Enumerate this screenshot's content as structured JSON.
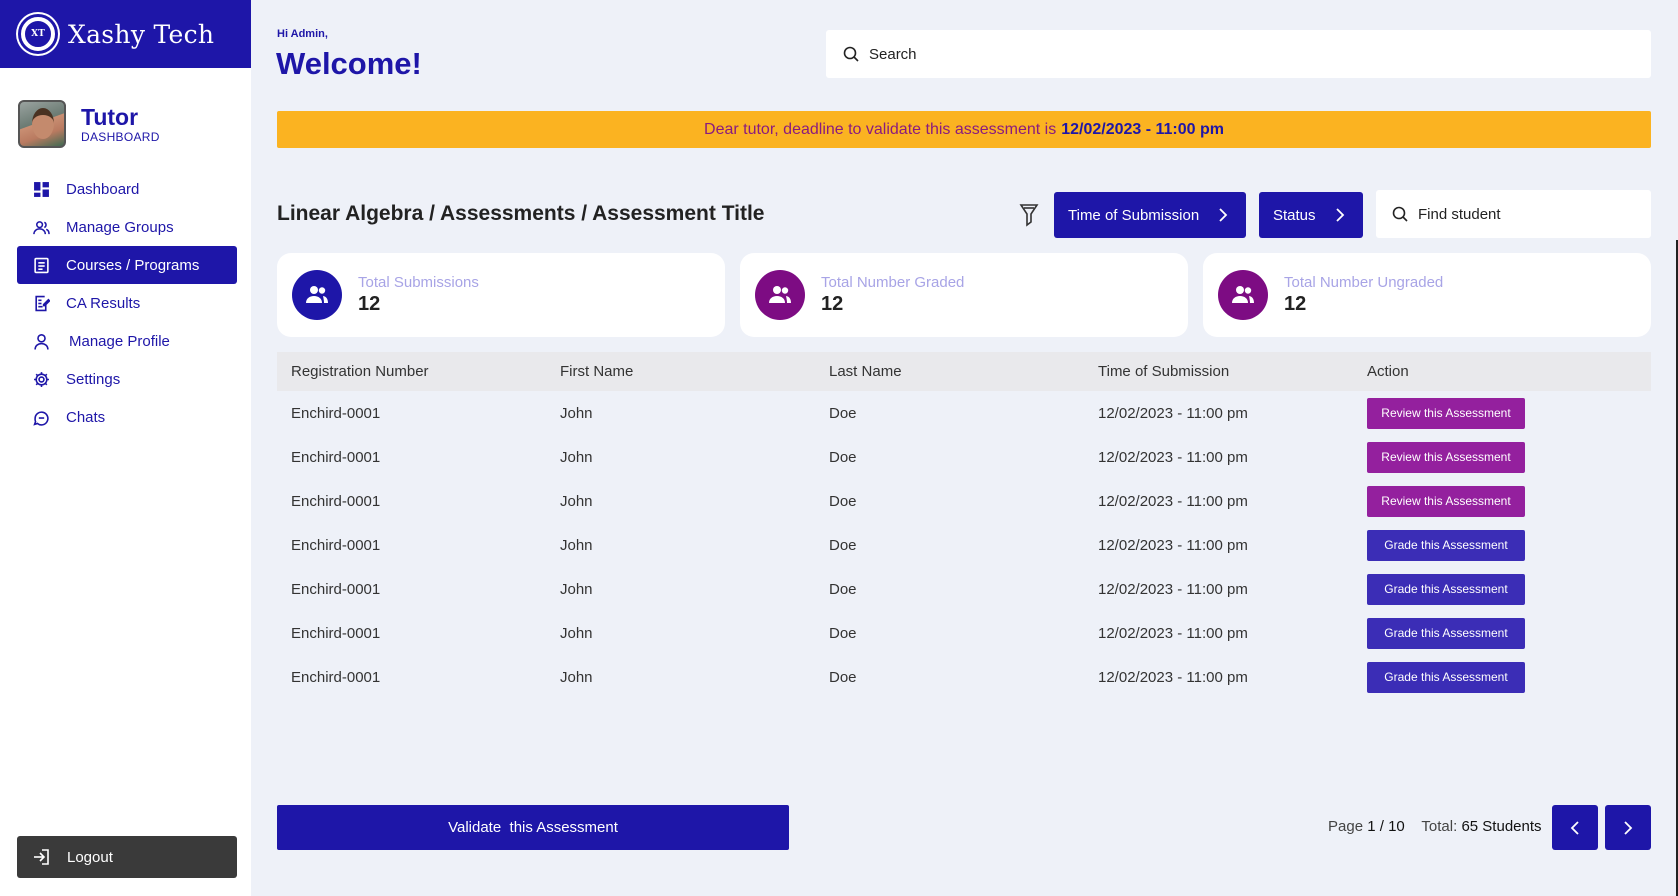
{
  "brand": {
    "name": "Xashy Tech",
    "logo_text": "XT"
  },
  "profile": {
    "role": "Tutor",
    "subtitle": "DASHBOARD"
  },
  "nav": [
    {
      "label": "Dashboard",
      "icon": "dashboard-icon"
    },
    {
      "label": "Manage Groups",
      "icon": "users-icon"
    },
    {
      "label": "Courses / Programs",
      "icon": "document-icon",
      "active": true
    },
    {
      "label": "CA Results",
      "icon": "edit-document-icon"
    },
    {
      "label": "Manage Profile",
      "icon": "user-icon"
    },
    {
      "label": "Settings",
      "icon": "gear-icon"
    },
    {
      "label": "Chats",
      "icon": "chat-icon"
    }
  ],
  "logout": {
    "label": "Logout",
    "icon": "logout-icon"
  },
  "header": {
    "greeting": "Hi Admin,",
    "title": "Welcome!",
    "search_placeholder": "Search"
  },
  "banner": {
    "text": "Dear tutor, deadline to validate this assessment is",
    "deadline": "12/02/2023 - 11:00 pm"
  },
  "breadcrumb": "Linear Algebra / Assessments / Assessment Title",
  "filters": {
    "time_label": "Time of Submission",
    "status_label": "Status",
    "find_placeholder": "Find student"
  },
  "stats": [
    {
      "label": "Total Submissions",
      "value": "12",
      "color": "#1e16a8"
    },
    {
      "label": "Total Number Graded",
      "value": "12",
      "color": "#7d0c83"
    },
    {
      "label": "Total Number Ungraded",
      "value": "12",
      "color": "#7d0c83"
    }
  ],
  "table": {
    "headers": [
      "Registration Number",
      "First Name",
      "Last Name",
      "Time of Submission",
      "Action"
    ],
    "rows": [
      {
        "reg": "Enchird-0001",
        "first": "John",
        "last": "Doe",
        "time": "12/02/2023 - 11:00 pm",
        "action": "Review this Assessment",
        "type": "review"
      },
      {
        "reg": "Enchird-0001",
        "first": "John",
        "last": "Doe",
        "time": "12/02/2023 - 11:00 pm",
        "action": "Review this Assessment",
        "type": "review"
      },
      {
        "reg": "Enchird-0001",
        "first": "John",
        "last": "Doe",
        "time": "12/02/2023 - 11:00 pm",
        "action": "Review this Assessment",
        "type": "review"
      },
      {
        "reg": "Enchird-0001",
        "first": "John",
        "last": "Doe",
        "time": "12/02/2023 - 11:00 pm",
        "action": "Grade this Assessment",
        "type": "grade"
      },
      {
        "reg": "Enchird-0001",
        "first": "John",
        "last": "Doe",
        "time": "12/02/2023 - 11:00 pm",
        "action": "Grade this Assessment",
        "type": "grade"
      },
      {
        "reg": "Enchird-0001",
        "first": "John",
        "last": "Doe",
        "time": "12/02/2023 - 11:00 pm",
        "action": "Grade this Assessment",
        "type": "grade"
      },
      {
        "reg": "Enchird-0001",
        "first": "John",
        "last": "Doe",
        "time": "12/02/2023 - 11:00 pm",
        "action": "Grade this Assessment",
        "type": "grade"
      }
    ]
  },
  "footer": {
    "validate_label": "Validate  this Assessment",
    "page_prefix": "Page",
    "page_value": "1 / 10",
    "total_prefix": "Total:",
    "total_value": "65 Students"
  },
  "colors": {
    "primary": "#1e16a8",
    "review": "#94209e",
    "grade": "#3b2db6",
    "banner": "#fbb321",
    "banner_text": "#8a1b7f"
  }
}
